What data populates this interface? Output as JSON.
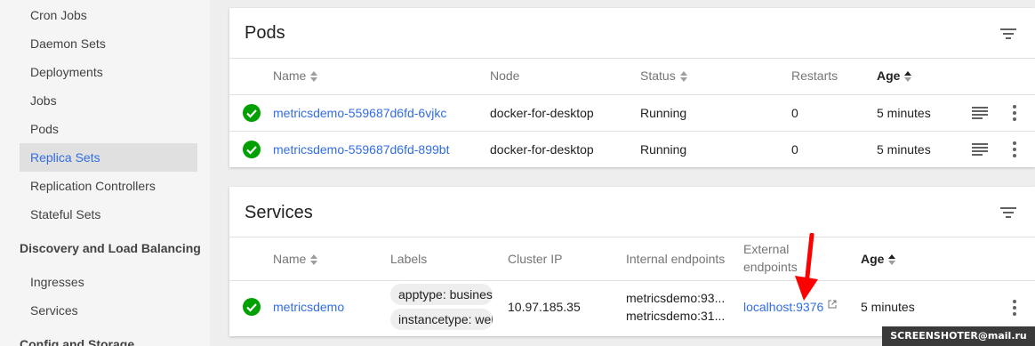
{
  "sidebar": {
    "items": [
      {
        "label": "Cron Jobs"
      },
      {
        "label": "Daemon Sets"
      },
      {
        "label": "Deployments"
      },
      {
        "label": "Jobs"
      },
      {
        "label": "Pods"
      },
      {
        "label": "Replica Sets"
      },
      {
        "label": "Replication Controllers"
      },
      {
        "label": "Stateful Sets"
      }
    ],
    "active": "Replica Sets",
    "sections": [
      {
        "label": "Discovery and Load Balancing",
        "items": [
          {
            "label": "Ingresses"
          },
          {
            "label": "Services"
          }
        ]
      },
      {
        "label": "Config and Storage"
      }
    ]
  },
  "pods": {
    "title": "Pods",
    "columns": {
      "name": "Name",
      "node": "Node",
      "status": "Status",
      "restarts": "Restarts",
      "age": "Age"
    },
    "rows": [
      {
        "name": "metricsdemo-559687d6fd-6vjkc",
        "node": "docker-for-desktop",
        "status": "Running",
        "restarts": "0",
        "age": "5 minutes"
      },
      {
        "name": "metricsdemo-559687d6fd-899bt",
        "node": "docker-for-desktop",
        "status": "Running",
        "restarts": "0",
        "age": "5 minutes"
      }
    ]
  },
  "services": {
    "title": "Services",
    "columns": {
      "name": "Name",
      "labels": "Labels",
      "cluster_ip": "Cluster IP",
      "internal": "Internal endpoints",
      "external_1": "External",
      "external_2": "endpoints",
      "age": "Age"
    },
    "rows": [
      {
        "name": "metricsdemo",
        "labels": [
          "apptype: busines",
          "instancetype: wel"
        ],
        "cluster_ip": "10.97.185.35",
        "internal": [
          "metricsdemo:93...",
          "metricsdemo:31..."
        ],
        "external": "localhost:9376",
        "age": "5 minutes"
      }
    ]
  },
  "colors": {
    "accent": "#326de6",
    "success": "#00a000",
    "arrow": "#ff0000"
  },
  "watermark": "SCREENSHOTER@mail.ru"
}
